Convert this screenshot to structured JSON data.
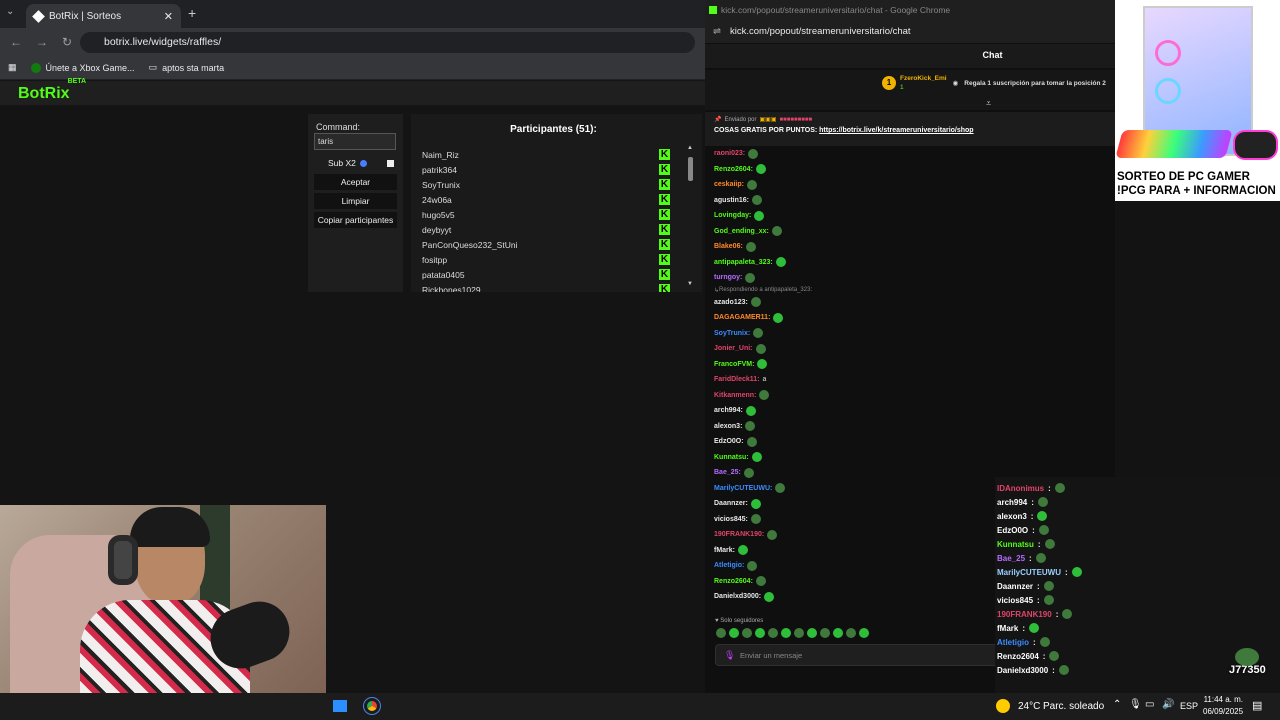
{
  "browser_left": {
    "tab_title": "BotRix | Sorteos",
    "url": "botrix.live/widgets/raffles/",
    "bookmarks": [
      "Únete a Xbox Game...",
      "aptos sta marta"
    ]
  },
  "botrix": {
    "logo": "BotRix",
    "logo_badge": "BETA",
    "command_label": "Command:",
    "command_value": "taris",
    "sub_x2_label": "Sub X2",
    "accept_label": "Aceptar",
    "clear_label": "Limpiar",
    "copy_label": "Copiar participantes",
    "participants_title": "Participantes (51):",
    "participants": [
      "Naim_Riz",
      "patrik364",
      "SoyTrunix",
      "24w06a",
      "hugo5v5",
      "deybyyt",
      "PanConQueso232_StUni",
      "fositpp",
      "patata0405",
      "Rickbones1029"
    ]
  },
  "kick_window": {
    "title": "kick.com/popout/streameruniversitario/chat - Google Chrome",
    "url": "kick.com/popout/streameruniversitario/chat",
    "chat_header": "Chat",
    "pinned_user": "FzeroKick_Emi",
    "pinned_count": "1",
    "pinned_text": "Regala 1 suscripción para tomar la posición 2",
    "sent_by": "Enviado por",
    "announce_text": "COSAS GRATIS POR PUNTOS:",
    "announce_link": "https://botrix.live/k/streameruniversitario/shop",
    "replying_to": "Respondiendo a antipapaleta_323:",
    "followers_only": "Solo seguidores",
    "send_placeholder": "Enviar un mensaje"
  },
  "chat_messages": [
    {
      "user": "raoni023:",
      "color": "#e0446a"
    },
    {
      "user": "Renzo2604:",
      "color": "#53fc18"
    },
    {
      "user": "ceskaiip:",
      "color": "#ff8a2a"
    },
    {
      "user": "agustin16:",
      "color": "#e8e8e8"
    },
    {
      "user": "Lovingday:",
      "color": "#53fc18"
    },
    {
      "user": "God_ending_xx:",
      "color": "#53fc18"
    },
    {
      "user": "Blake06:",
      "color": "#ff8a2a"
    },
    {
      "user": "antipapaleta_323:",
      "color": "#53fc18"
    },
    {
      "user": "turngoy:",
      "color": "#b46cff"
    },
    {
      "user": "azado123:",
      "color": "#e8e8e8"
    },
    {
      "user": "DAGAGAMER11:",
      "color": "#ff8a2a"
    },
    {
      "user": "SoyTrunix:",
      "color": "#3a8cff"
    },
    {
      "user": "Jonier_Uni:",
      "color": "#e0446a"
    },
    {
      "user": "FrancoFVM:",
      "color": "#53fc18"
    },
    {
      "user": "FaridDleck11:",
      "color": "#e0446a",
      "text": "a"
    },
    {
      "user": "Kitkanmenn:",
      "color": "#e0446a"
    },
    {
      "user": "arch994:",
      "color": "#e8e8e8"
    },
    {
      "user": "alexon3:",
      "color": "#e8e8e8"
    },
    {
      "user": "EdzO0O:",
      "color": "#e8e8e8"
    },
    {
      "user": "Kunnatsu:",
      "color": "#53fc18"
    },
    {
      "user": "Bae_25:",
      "color": "#b46cff"
    },
    {
      "user": "MarilyCUTEUWU:",
      "color": "#3a8cff"
    },
    {
      "user": "Daannzer:",
      "color": "#e8e8e8"
    },
    {
      "user": "vicios845:",
      "color": "#e8e8e8"
    },
    {
      "user": "190FRANK190:",
      "color": "#e0446a"
    },
    {
      "user": "fMark:",
      "color": "#e8e8e8"
    },
    {
      "user": "Atletigio:",
      "color": "#3a8cff"
    },
    {
      "user": "Renzo2604:",
      "color": "#53fc18"
    },
    {
      "user": "Danielxd3000:",
      "color": "#e8e8e8"
    }
  ],
  "promo": {
    "line1": "SORTEO DE PC GAMER",
    "line2": "!PCG PARA + INFORMACION"
  },
  "overlay_chat": [
    {
      "user": "IDAnonimus",
      "color": "#e0446a"
    },
    {
      "user": "arch994",
      "color": "#ffffff"
    },
    {
      "user": "alexon3",
      "color": "#ffffff"
    },
    {
      "user": "EdzO0O",
      "color": "#ffffff"
    },
    {
      "user": "Kunnatsu",
      "color": "#53fc18"
    },
    {
      "user": "Bae_25",
      "color": "#b46cff"
    },
    {
      "user": "MarilyCUTEUWU",
      "color": "#9ad0ff"
    },
    {
      "user": "Daannzer",
      "color": "#ffffff"
    },
    {
      "user": "vicios845",
      "color": "#ffffff"
    },
    {
      "user": "190FRANK190",
      "color": "#e0446a"
    },
    {
      "user": "fMark",
      "color": "#ffffff"
    },
    {
      "user": "Atletigio",
      "color": "#3a8cff"
    },
    {
      "user": "Renzo2604",
      "color": "#ffffff"
    },
    {
      "user": "Danielxd3000",
      "color": "#ffffff"
    }
  ],
  "overlay_counter": "J77350",
  "taskbar": {
    "weather": "24°C",
    "weather_desc": "Parc. soleado",
    "lang": "ESP",
    "time": "11:44 a. m.",
    "date": "06/09/2025"
  },
  "colors": {
    "kick_green": "#53fc18",
    "chrome_dark": "#202124"
  }
}
